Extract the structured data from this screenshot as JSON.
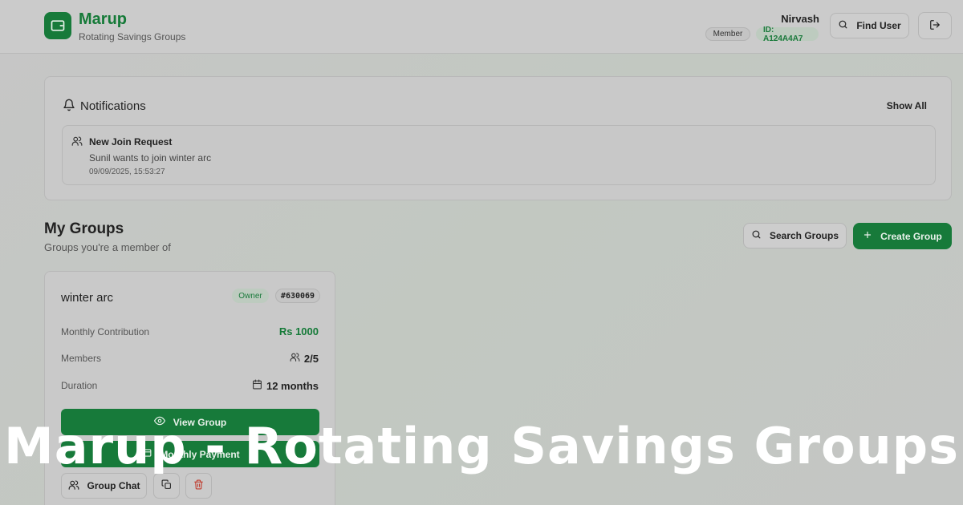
{
  "header": {
    "brand_title": "Marup",
    "brand_subtitle": "Rotating Savings Groups",
    "user_name": "Nirvash",
    "role_badge": "Member",
    "user_id": "ID: A124A4A7",
    "find_user_label": "Find User"
  },
  "notifications": {
    "title": "Notifications",
    "show_all_label": "Show All",
    "items": [
      {
        "title": "New Join Request",
        "message": "Sunil wants to join winter arc",
        "timestamp": "09/09/2025, 15:53:27"
      }
    ]
  },
  "groups": {
    "title": "My Groups",
    "subtitle": "Groups you're a member of",
    "search_label": "Search Groups",
    "create_label": "Create Group",
    "cards": [
      {
        "name": "winter arc",
        "role": "Owner",
        "code": "#630069",
        "contribution_label": "Monthly Contribution",
        "contribution_value": "Rs 1000",
        "members_label": "Members",
        "members_value": "2/5",
        "duration_label": "Duration",
        "duration_value": "12 months",
        "view_label": "View Group",
        "payment_label": "Monthly Payment",
        "chat_label": "Group Chat"
      }
    ]
  },
  "overlay_title": "Marup - Rotating Savings Groups",
  "colors": {
    "brand_green": "#177a3a",
    "page_bg": "#c6c6c6",
    "card_bg": "#c9c9c9",
    "delete_red": "#c0392b"
  }
}
